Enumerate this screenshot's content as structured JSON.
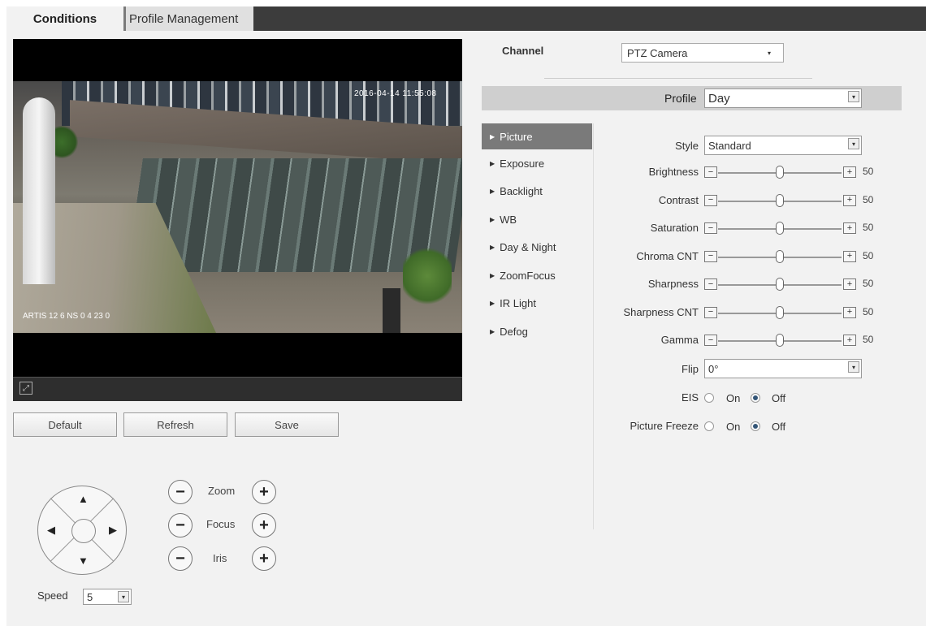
{
  "tabs": {
    "conditions": "Conditions",
    "profile_management": "Profile Management"
  },
  "video": {
    "osd_time": "2016-04-14 11:55:08",
    "osd_name": "ARTIS 12 6 NS 0 4 23 0"
  },
  "buttons": {
    "default": "Default",
    "refresh": "Refresh",
    "save": "Save"
  },
  "ptz": {
    "zoom": "Zoom",
    "focus": "Focus",
    "iris": "Iris",
    "minus": "−",
    "plus": "+",
    "speed_label": "Speed",
    "speed_value": "5"
  },
  "channel": {
    "label": "Channel",
    "value": "PTZ Camera"
  },
  "profile": {
    "label": "Profile",
    "value": "Day"
  },
  "menu": [
    {
      "label": "Picture"
    },
    {
      "label": "Exposure"
    },
    {
      "label": "Backlight"
    },
    {
      "label": "WB"
    },
    {
      "label": "Day & Night"
    },
    {
      "label": "ZoomFocus"
    },
    {
      "label": "IR Light"
    },
    {
      "label": "Defog"
    }
  ],
  "picture": {
    "style_label": "Style",
    "style_value": "Standard",
    "sliders": [
      {
        "label": "Brightness",
        "value": "50"
      },
      {
        "label": "Contrast",
        "value": "50"
      },
      {
        "label": "Saturation",
        "value": "50"
      },
      {
        "label": "Chroma CNT",
        "value": "50"
      },
      {
        "label": "Sharpness",
        "value": "50"
      },
      {
        "label": "Sharpness CNT",
        "value": "50"
      },
      {
        "label": "Gamma",
        "value": "50"
      }
    ],
    "flip_label": "Flip",
    "flip_value": "0°",
    "eis_label": "EIS",
    "freeze_label": "Picture Freeze",
    "on": "On",
    "off": "Off"
  },
  "icons": {
    "dropdown": "▾",
    "fullscreen": "⤢",
    "up": "▲",
    "down": "▼",
    "left": "◀",
    "right": "▶",
    "menu_arrow": "▶",
    "slider_minus": "−",
    "slider_plus": "+"
  }
}
